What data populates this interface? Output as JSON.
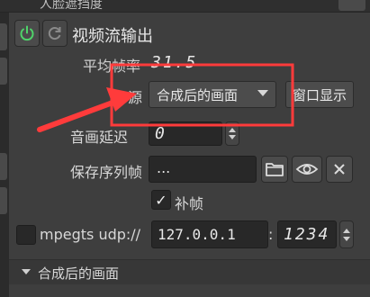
{
  "prev_section": {
    "label": "人脸遮挡度"
  },
  "stream": {
    "title": "视频流输出",
    "power_icon": "power-icon",
    "reset_icon": "refresh-icon",
    "avg_fps_label": "平均帧率",
    "avg_fps_value": "31.5",
    "source_label": "源",
    "source_value": "合成后的画面",
    "window_button": "窗口显示",
    "av_delay_label": "音画延迟",
    "av_delay_value": "0",
    "save_frames_label": "保存序列帧",
    "save_frames_value": "...",
    "fill_frames_label": "补帧",
    "fill_frames_checked": true,
    "mpegts_label": "mpegts udp://",
    "ip_value": "127.0.0.1",
    "port_sep": ":",
    "port_value": "1234"
  },
  "next_section": {
    "label": "合成后的画面"
  },
  "colors": {
    "power": "#4fd36a",
    "annotation": "#ff3b3b"
  }
}
